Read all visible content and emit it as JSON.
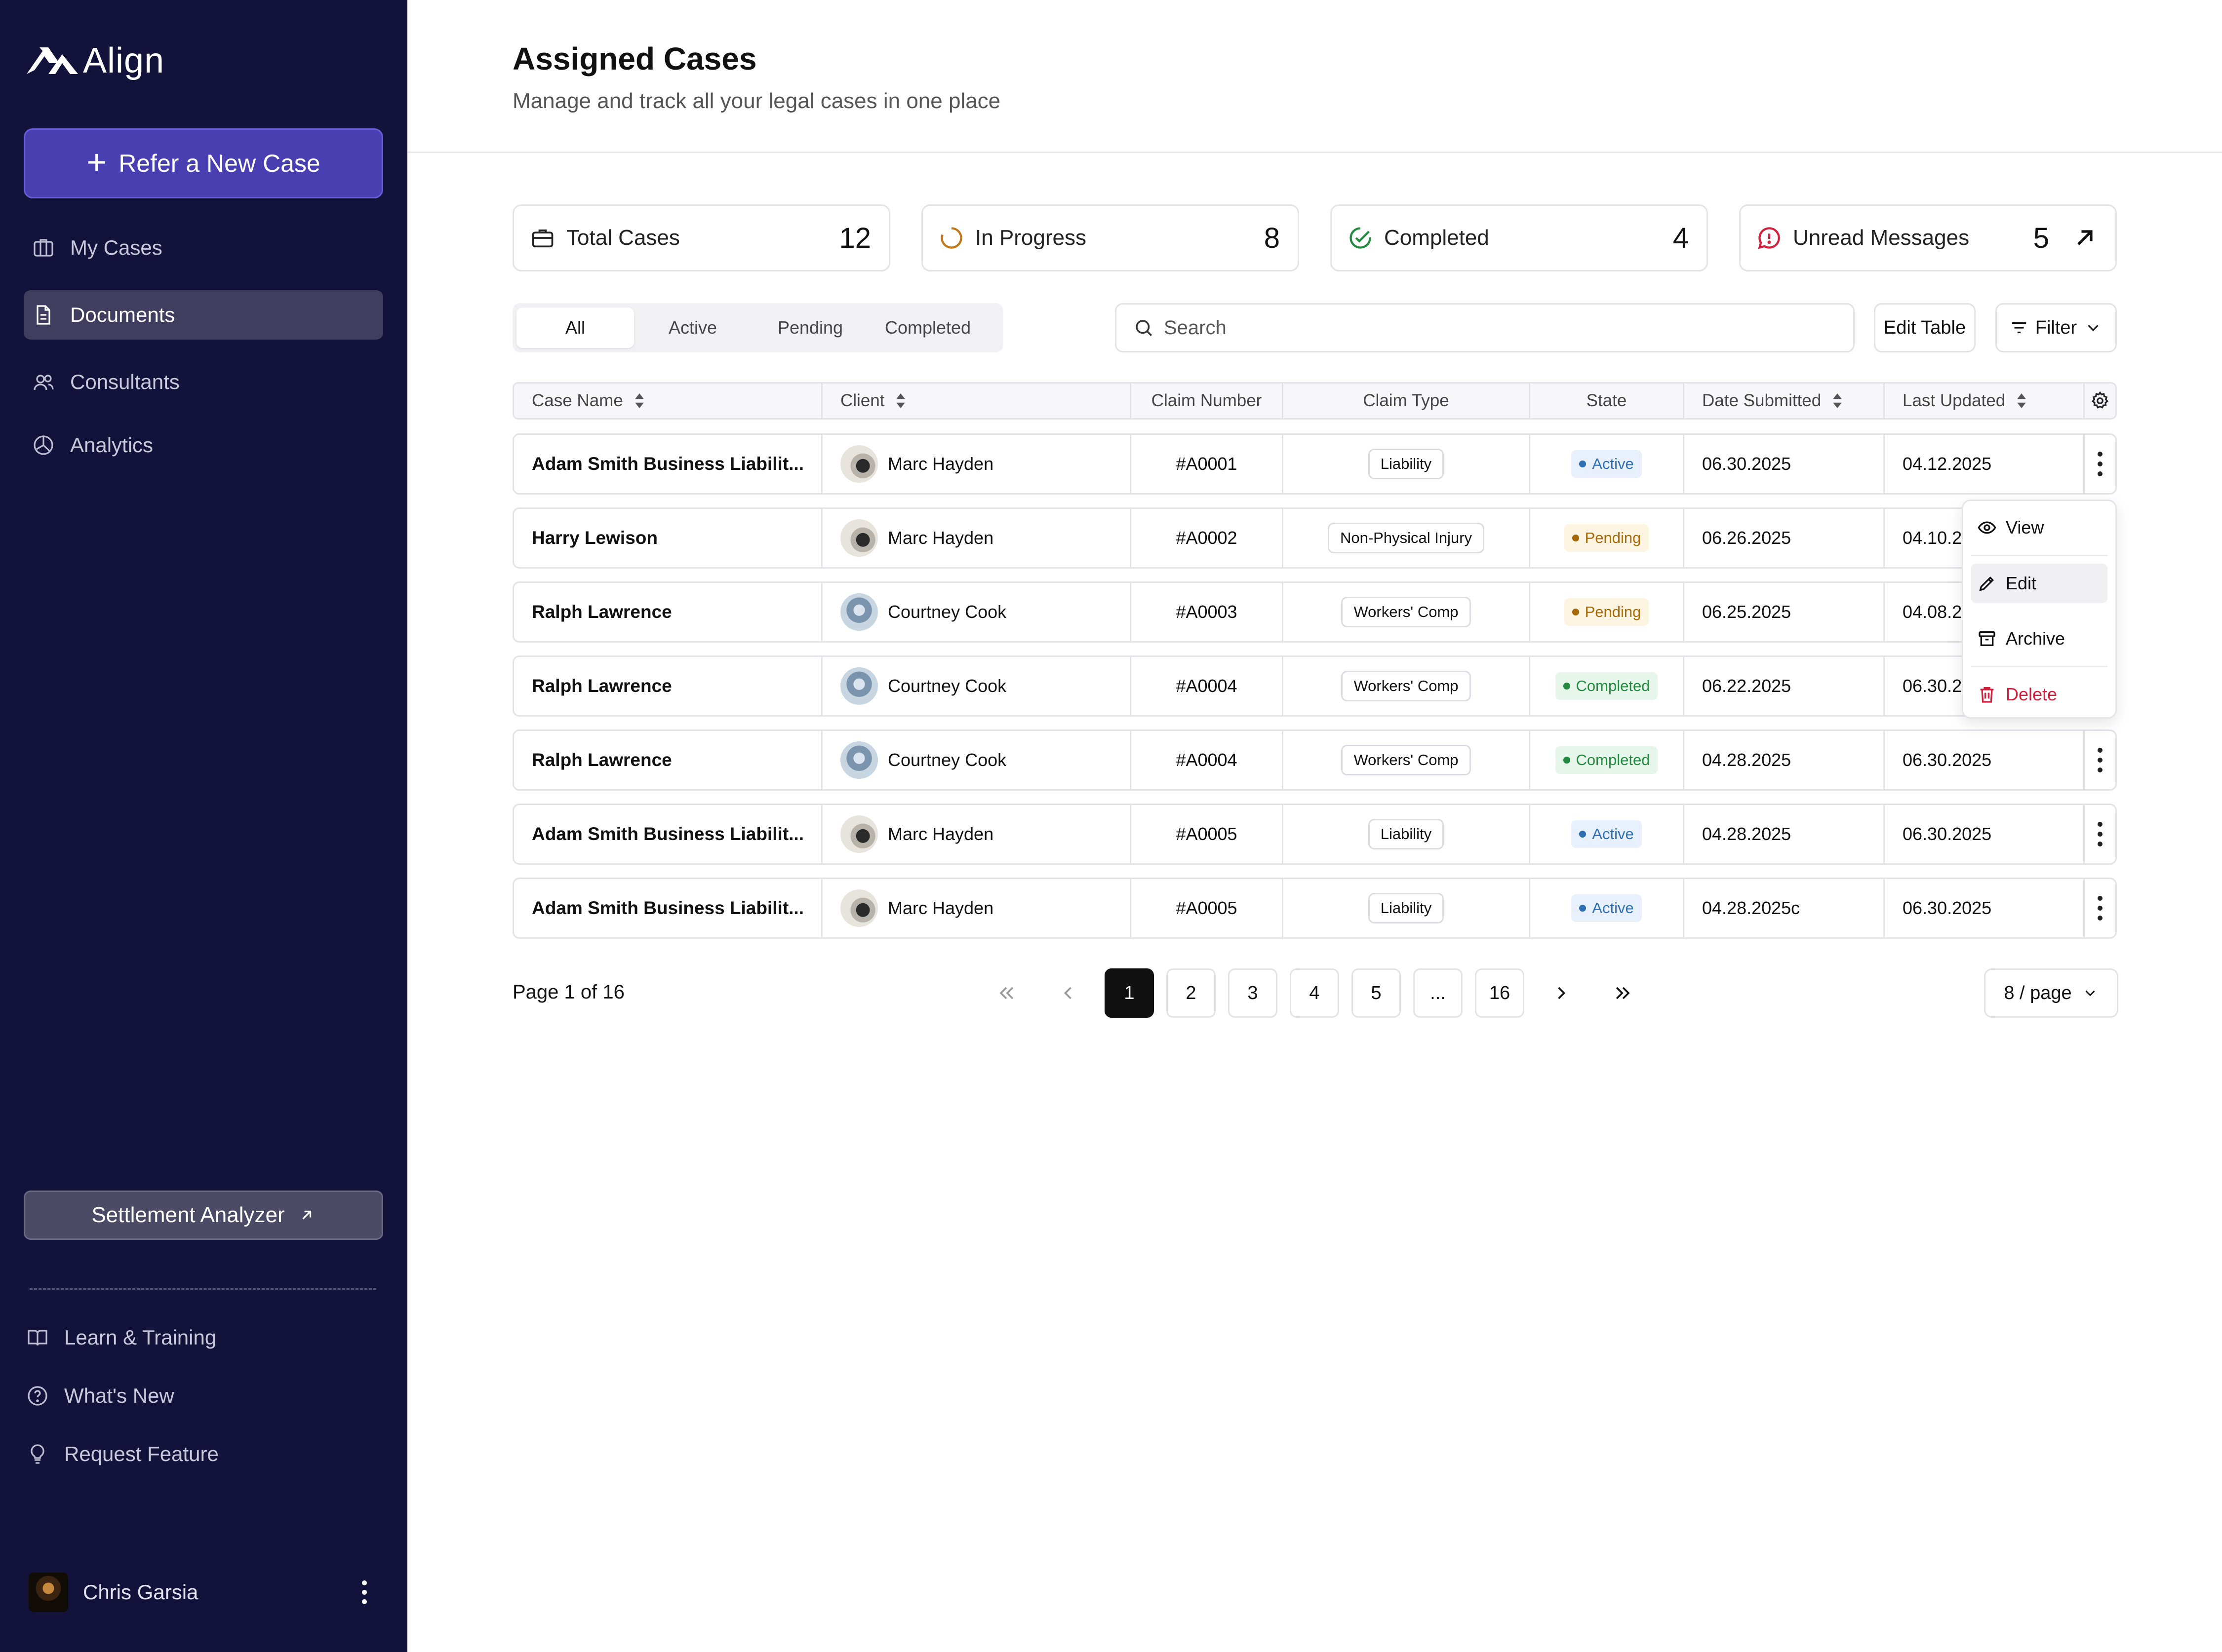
{
  "brand": {
    "name": "Align"
  },
  "sidebar": {
    "refer_label": "Refer a New Case",
    "items": [
      {
        "label": "My Cases",
        "icon": "briefcase-icon"
      },
      {
        "label": "Documents",
        "icon": "document-icon",
        "active": true
      },
      {
        "label": "Consultants",
        "icon": "users-icon"
      },
      {
        "label": "Analytics",
        "icon": "pie-chart-icon"
      }
    ],
    "settlement_label": "Settlement Analyzer",
    "bottom_items": [
      {
        "label": "Learn & Training",
        "icon": "book-icon"
      },
      {
        "label": "What's New",
        "icon": "question-circle-icon"
      },
      {
        "label": "Request Feature",
        "icon": "lightbulb-icon"
      }
    ],
    "user": {
      "name": "Chris Garsia"
    }
  },
  "header": {
    "title": "Assigned Cases",
    "subtitle": "Manage and track all your legal cases in one place"
  },
  "stats": [
    {
      "label": "Total Cases",
      "value": "12",
      "icon": "briefcase-icon"
    },
    {
      "label": "In Progress",
      "value": "8",
      "icon": "progress-icon"
    },
    {
      "label": "Completed",
      "value": "4",
      "icon": "check-circle-icon"
    },
    {
      "label": "Unread Messages",
      "value": "5",
      "icon": "alert-message-icon"
    }
  ],
  "tabs": [
    {
      "label": "All",
      "active": true
    },
    {
      "label": "Active"
    },
    {
      "label": "Pending"
    },
    {
      "label": "Completed"
    }
  ],
  "search": {
    "placeholder": "Search"
  },
  "toolbar": {
    "edit_table": "Edit Table",
    "filter": "Filter"
  },
  "table": {
    "columns": [
      "Case Name",
      "Client",
      "Claim Number",
      "Claim Type",
      "State",
      "Date Submitted",
      "Last Updated"
    ],
    "rows": [
      {
        "case": "Adam Smith Business Liabilit...",
        "client": "Marc Hayden",
        "claim": "#A0001",
        "type": "Liability",
        "state": "Active",
        "submitted": "06.30.2025",
        "updated": "04.12.2025"
      },
      {
        "case": "Harry Lewison",
        "client": "Marc Hayden",
        "claim": "#A0002",
        "type": "Non-Physical Injury",
        "state": "Pending",
        "submitted": "06.26.2025",
        "updated": "04.10.2025"
      },
      {
        "case": "Ralph Lawrence",
        "client": "Courtney Cook",
        "claim": "#A0003",
        "type": "Workers' Comp",
        "state": "Pending",
        "submitted": "06.25.2025",
        "updated": "04.08.2025"
      },
      {
        "case": "Ralph Lawrence",
        "client": "Courtney Cook",
        "claim": "#A0004",
        "type": "Workers' Comp",
        "state": "Completed",
        "submitted": "06.22.2025",
        "updated": "06.30.2025"
      },
      {
        "case": "Ralph Lawrence",
        "client": "Courtney Cook",
        "claim": "#A0004",
        "type": "Workers' Comp",
        "state": "Completed",
        "submitted": "04.28.2025",
        "updated": "06.30.2025"
      },
      {
        "case": "Adam Smith Business Liabilit...",
        "client": "Marc Hayden",
        "claim": "#A0005",
        "type": "Liability",
        "state": "Active",
        "submitted": "04.28.2025",
        "updated": "06.30.2025"
      },
      {
        "case": "Adam Smith Business Liabilit...",
        "client": "Marc Hayden",
        "claim": "#A0005",
        "type": "Liability",
        "state": "Active",
        "submitted": "04.28.2025c",
        "updated": "06.30.2025"
      }
    ]
  },
  "context_menu": {
    "view": "View",
    "edit": "Edit",
    "archive": "Archive",
    "delete": "Delete"
  },
  "pagination": {
    "info": "Page 1 of 16",
    "pages": [
      "1",
      "2",
      "3",
      "4",
      "5",
      "...",
      "16"
    ],
    "current": "1",
    "per_page": "8 / page"
  },
  "colors": {
    "sidebar_bg": "#13123a",
    "accent": "#4a3fb0",
    "active": "#2f6fb3",
    "pending": "#a66a0b",
    "completed": "#238a3f",
    "danger": "#d0223f"
  }
}
